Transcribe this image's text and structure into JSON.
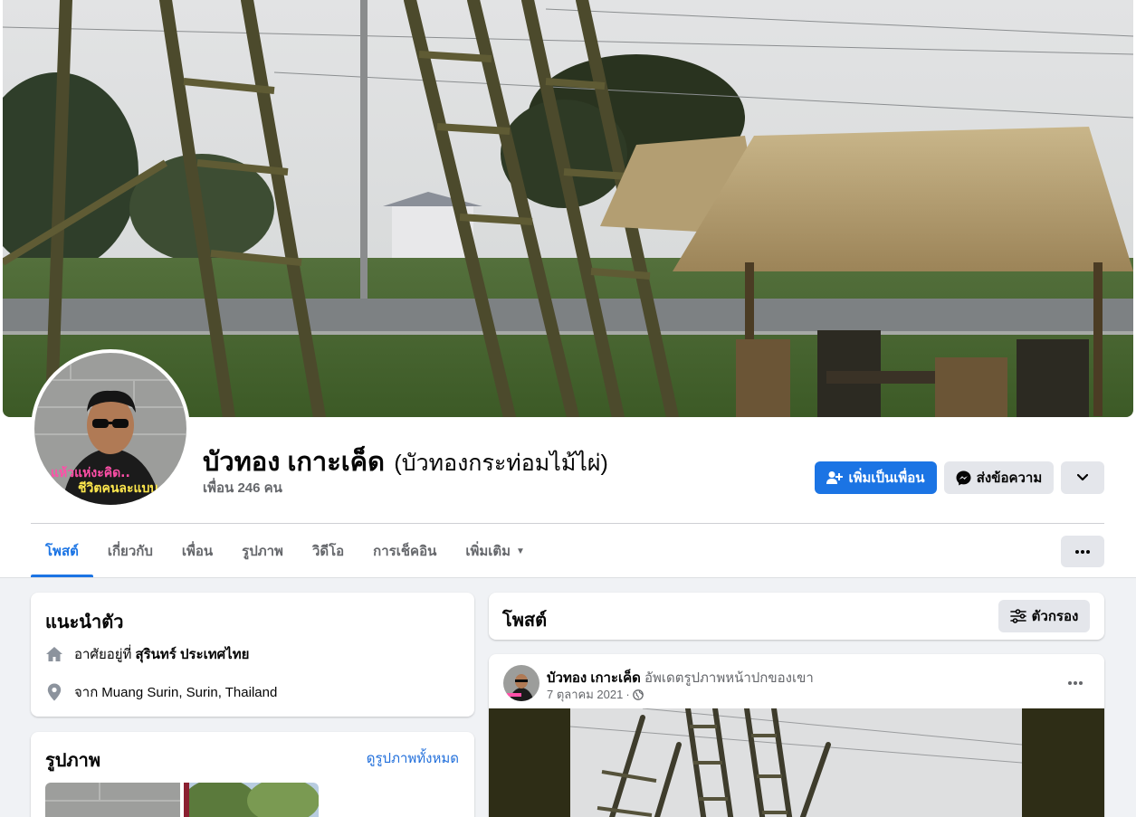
{
  "profile": {
    "name": "บัวทอง เกาะเค็ด",
    "alt_name": "(บัวทองกระท่อมไม้ไผ่)",
    "friends": "เพื่อน 246 คน",
    "avatar_caption_1": "แห้วแห่งะคิด..",
    "avatar_caption_2": "ชีวิตคนละแบบ.."
  },
  "actions": {
    "add_friend": "เพิ่มเป็นเพื่อน",
    "message": "ส่งข้อความ"
  },
  "tabs": [
    {
      "label": "โพสต์"
    },
    {
      "label": "เกี่ยวกับ"
    },
    {
      "label": "เพื่อน"
    },
    {
      "label": "รูปภาพ"
    },
    {
      "label": "วิดีโอ"
    },
    {
      "label": "การเช็คอิน"
    },
    {
      "label": "เพิ่มเติม"
    }
  ],
  "intro": {
    "title": "แนะนำตัว",
    "lives_prefix": "อาศัยอยู่ที่",
    "lives_place": "สุรินทร์ ประเทศไทย",
    "from_prefix": "จาก",
    "from_place": "Muang Surin, Surin, Thailand"
  },
  "photos": {
    "title": "รูปภาพ",
    "see_all": "ดูรูปภาพทั้งหมด"
  },
  "posts_header": {
    "title": "โพสต์",
    "filter": "ตัวกรอง"
  },
  "post": {
    "author": "บัวทอง เกาะเค็ด",
    "action": "อัพเดตรูปภาพหน้าปกของเขา",
    "date": "7 ตุลาคม 2021",
    "dot": "·"
  },
  "colors": {
    "accent": "#1b74e4",
    "link": "#216fdb",
    "secondary_text": "#65676b",
    "page_background": "#f0f2f5"
  },
  "icons": [
    "add-friend-icon",
    "messenger-icon",
    "chevron-down-icon",
    "more-dots-icon",
    "home-icon",
    "location-pin-icon",
    "filter-icon",
    "globe-icon"
  ]
}
